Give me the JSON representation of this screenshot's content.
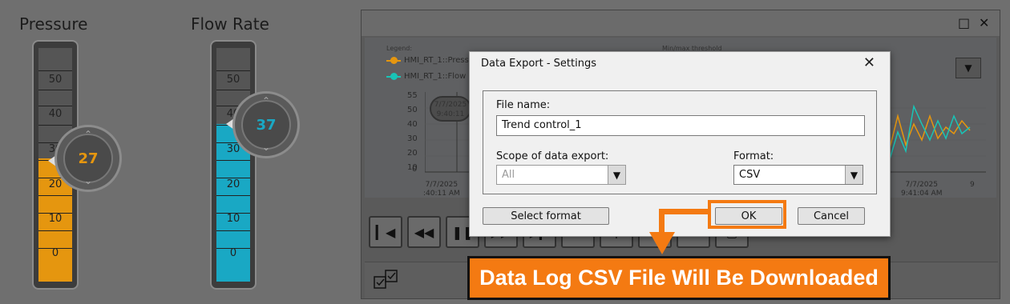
{
  "gauges": {
    "pressure": {
      "title": "Pressure",
      "value": "27",
      "value_color": "#e5960f",
      "fill_color": "#e5960f",
      "level": 27,
      "ticks": [
        "50",
        "40",
        "30",
        "20",
        "10",
        "0"
      ]
    },
    "flow": {
      "title": "Flow Rate",
      "value": "37",
      "value_color": "#1aa8c4",
      "fill_color": "#19a8c4",
      "level": 37,
      "ticks": [
        "50",
        "40",
        "30",
        "20",
        "10",
        "0"
      ]
    }
  },
  "trend": {
    "legend_caption": "Legend:",
    "threshold_caption": "Min/max threshold",
    "series": [
      {
        "label": "HMI_RT_1::Press",
        "color": "#e5960f"
      },
      {
        "label": "HMI_RT_1::Flow",
        "color": "#19c4b6"
      }
    ],
    "y_ticks": [
      "55",
      "50",
      "40",
      "30",
      "20",
      "10",
      "0"
    ],
    "cursor_date": "7/7/2025",
    "cursor_time": "9:40:11",
    "x_labels": [
      {
        "date": "7/7/2025",
        "time": ":40:11 AM"
      },
      {
        "date": "7/7/2025",
        "time": "9:41:04 AM"
      },
      {
        "date": "",
        "time": "9"
      }
    ],
    "toolbar_icons": [
      "first-icon",
      "rewind-icon",
      "pause-icon",
      "forward-icon",
      "last-icon",
      "ruler-icon",
      "zoom-in-icon",
      "zoom-out-icon",
      "reset-icon",
      "zoom-area-icon"
    ]
  },
  "dialog": {
    "title": "Data Export - Settings",
    "file_name_label": "File name:",
    "file_name_value": "Trend control_1",
    "scope_label": "Scope of data export:",
    "scope_value": "All",
    "format_label": "Format:",
    "format_value": "CSV",
    "select_format_button": "Select format",
    "ok_button": "OK",
    "cancel_button": "Cancel"
  },
  "annotation": {
    "callout_text": "Data Log CSV File Will Be Downloaded",
    "accent_color": "#f47a12"
  }
}
